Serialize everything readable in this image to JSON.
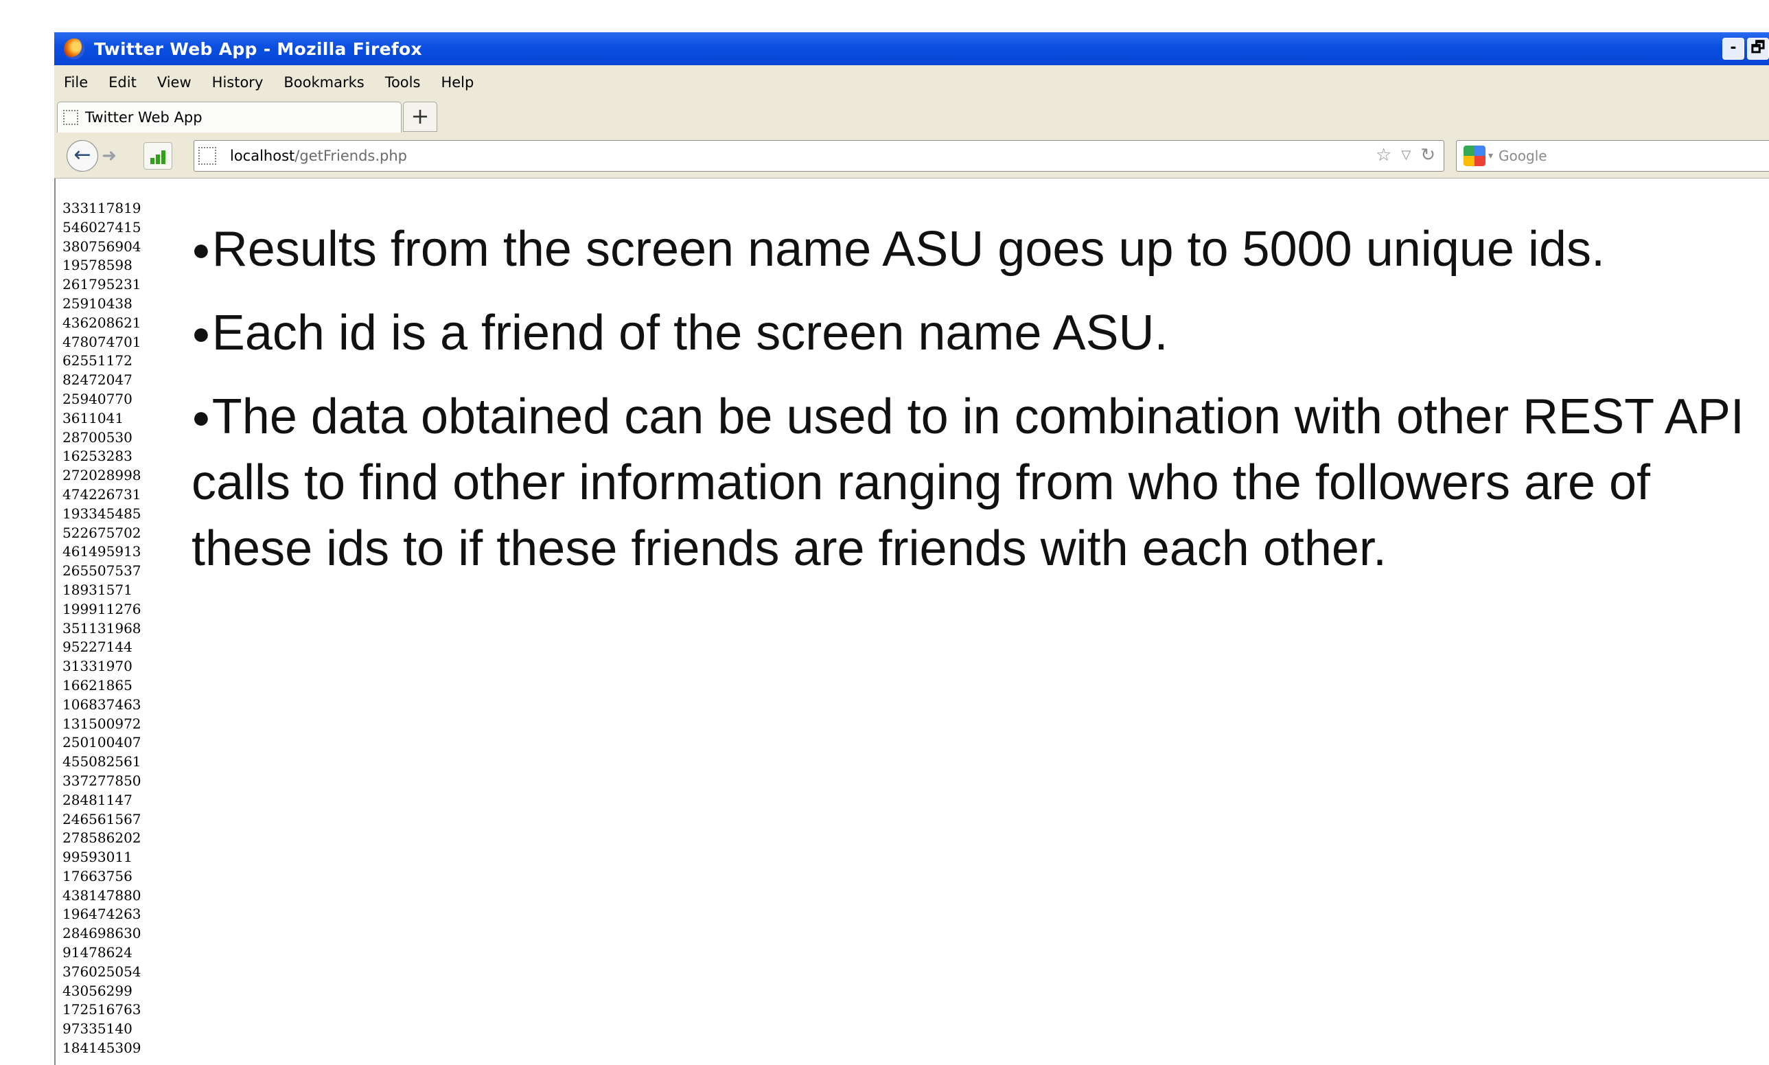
{
  "window": {
    "title": "Twitter Web App - Mozilla Firefox",
    "controls": [
      "-",
      "🗗"
    ]
  },
  "menu": [
    "File",
    "Edit",
    "View",
    "History",
    "Bookmarks",
    "Tools",
    "Help"
  ],
  "tab": {
    "label": "Twitter Web App",
    "new_tab": "+"
  },
  "address": {
    "host": "localhost",
    "path": "/getFriends.php"
  },
  "search": {
    "placeholder": "Google"
  },
  "ids": [
    "333117819",
    "546027415",
    "380756904",
    "19578598",
    "261795231",
    "25910438",
    "436208621",
    "478074701",
    "62551172",
    "82472047",
    "25940770",
    "3611041",
    "28700530",
    "16253283",
    "272028998",
    "474226731",
    "193345485",
    "522675702",
    "461495913",
    "265507537",
    "18931571",
    "199911276",
    "351131968",
    "95227144",
    "31331970",
    "16621865",
    "106837463",
    "131500972",
    "250100407",
    "455082561",
    "337277850",
    "28481147",
    "246561567",
    "278586202",
    "99593011",
    "17663756",
    "438147880",
    "196474263",
    "284698630",
    "91478624",
    "376025054",
    "43056299",
    "172516763",
    "97335140",
    "184145309"
  ],
  "bullets": [
    "Results from the screen name ASU goes up to 5000 unique ids.",
    "Each id is a friend of the screen name ASU.",
    "The data obtained can be used to in combination with other REST API calls to find other information ranging from who the followers are of these ids to if these friends are friends with each other."
  ]
}
